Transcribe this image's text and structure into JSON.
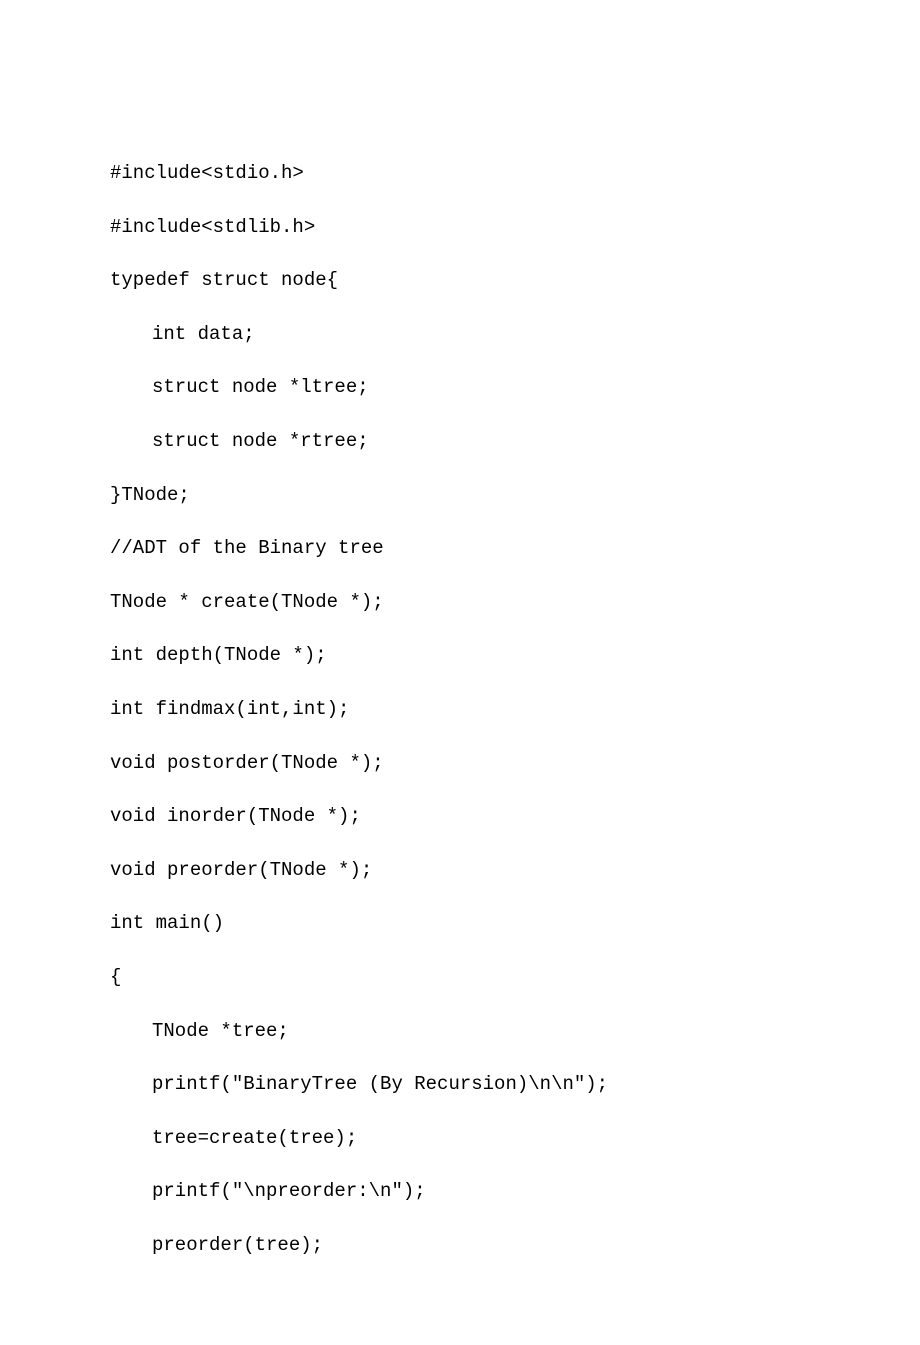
{
  "code": {
    "lines": [
      {
        "text": "#include<stdio.h>",
        "indent": 0
      },
      {
        "text": "#include<stdlib.h>",
        "indent": 0
      },
      {
        "text": "typedef struct node{",
        "indent": 0
      },
      {
        "text": "int data;",
        "indent": 1
      },
      {
        "text": "struct node *ltree;",
        "indent": 1
      },
      {
        "text": "struct node *rtree;",
        "indent": 1
      },
      {
        "text": "}TNode;",
        "indent": 0
      },
      {
        "text": "//ADT of the Binary tree",
        "indent": 0
      },
      {
        "text": "TNode * create(TNode *);",
        "indent": 0
      },
      {
        "text": "int depth(TNode *);",
        "indent": 0
      },
      {
        "text": "int findmax(int,int);",
        "indent": 0
      },
      {
        "text": "void postorder(TNode *);",
        "indent": 0
      },
      {
        "text": "void inorder(TNode *);",
        "indent": 0
      },
      {
        "text": "void preorder(TNode *);",
        "indent": 0
      },
      {
        "text": "int main()",
        "indent": 0
      },
      {
        "text": "{",
        "indent": 0
      },
      {
        "text": "TNode *tree;",
        "indent": 1
      },
      {
        "text": "printf(\"BinaryTree (By Recursion)\\n\\n\");",
        "indent": 1
      },
      {
        "text": "tree=create(tree);",
        "indent": 1
      },
      {
        "text": "printf(\"\\npreorder:\\n\");",
        "indent": 1
      },
      {
        "text": "preorder(tree);",
        "indent": 1
      }
    ]
  }
}
